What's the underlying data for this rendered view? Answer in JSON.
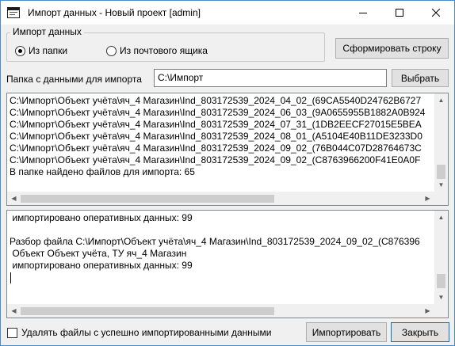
{
  "window": {
    "title": "Импорт данных - Новый проект [admin]"
  },
  "source_group": {
    "legend": "Импорт данных",
    "options": [
      {
        "label": "Из папки",
        "checked": true
      },
      {
        "label": "Из почтового ящика",
        "checked": false
      }
    ]
  },
  "buttons": {
    "build_string": "Сформировать строку",
    "browse": "Выбрать",
    "import": "Импортировать",
    "close": "Закрыть"
  },
  "folder": {
    "label": "Папка с данными для импорта",
    "value": "C:\\Импорт"
  },
  "file_list": {
    "lines": [
      "C:\\Импорт\\Объект учёта\\яч_4 Магазин\\Ind_803172539_2024_04_02_(69CA5540D24762B6727",
      "C:\\Импорт\\Объект учёта\\яч_4 Магазин\\Ind_803172539_2024_06_03_(9A0655955B1882A0B924",
      "C:\\Импорт\\Объект учёта\\яч_4 Магазин\\Ind_803172539_2024_07_31_(1DB2EECF27015E5BEA",
      "C:\\Импорт\\Объект учёта\\яч_4 Магазин\\Ind_803172539_2024_08_01_(A5104E40B11DE3233D0",
      "C:\\Импорт\\Объект учёта\\яч_4 Магазин\\Ind_803172539_2024_09_02_(76B044C07D28764673C",
      "C:\\Импорт\\Объект учёта\\яч_4 Магазин\\Ind_803172539_2024_09_02_(C8763966200F41E0A0F",
      "В папке найдено файлов для импорта: 65"
    ]
  },
  "log": {
    "lines": [
      " импортировано оперативных данных: 99",
      "",
      "Разбор файла C:\\Импорт\\Объект учёта\\яч_4 Магазин\\Ind_803172539_2024_09_02_(C876396",
      " Объект Объект учёта, ТУ яч_4 Магазин",
      " импортировано оперативных данных: 99"
    ]
  },
  "delete_checkbox": {
    "label": "Удалять файлы с успешно импортированными данными",
    "checked": false
  },
  "icons": {
    "app": "app-window-icon",
    "minimize": "minimize-icon",
    "maximize": "maximize-icon",
    "close": "close-icon"
  }
}
